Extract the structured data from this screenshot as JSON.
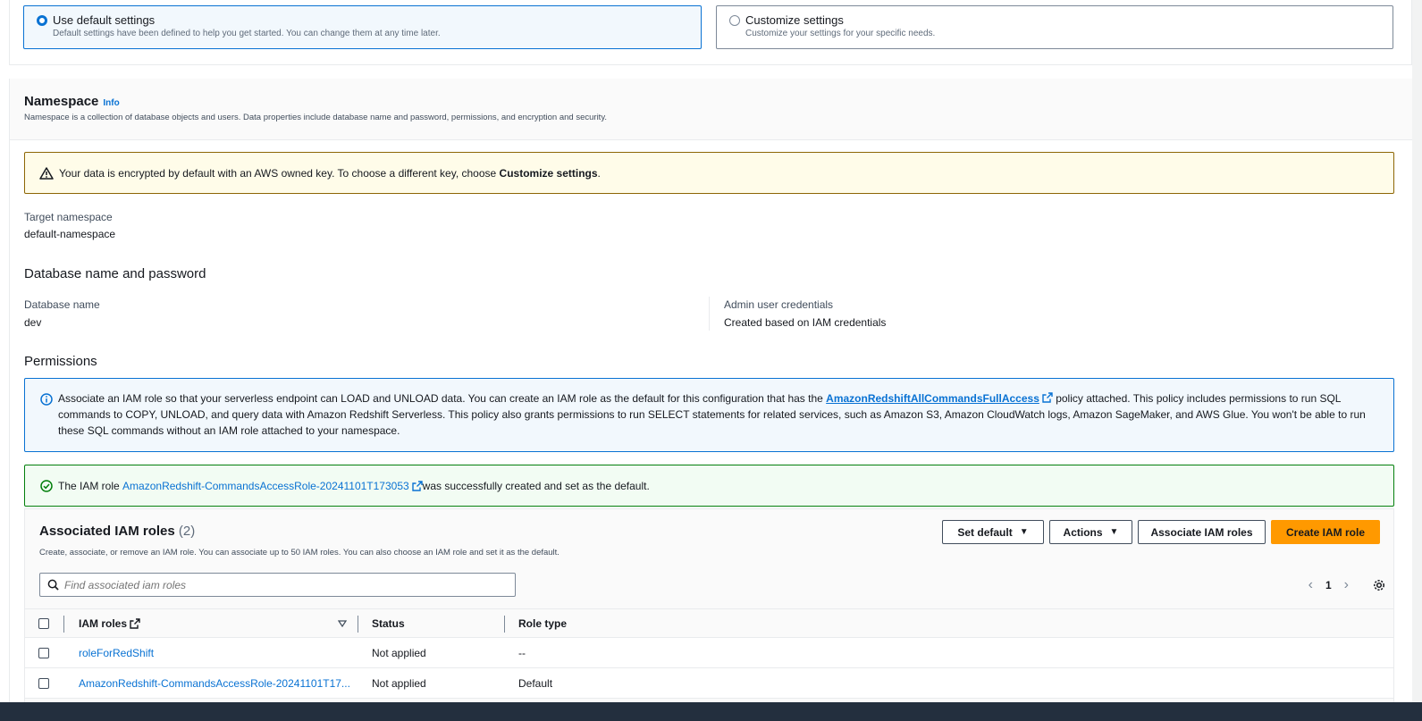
{
  "settings": {
    "default_option": {
      "title": "Use default settings",
      "description": "Default settings have been defined to help you get started. You can change them at any time later.",
      "selected": true
    },
    "custom_option": {
      "title": "Customize settings",
      "description": "Customize your settings for your specific needs.",
      "selected": false
    }
  },
  "namespace": {
    "title": "Namespace",
    "info_label": "Info",
    "description": "Namespace is a collection of database objects and users. Data properties include database name and password, permissions, and encryption and security.",
    "warning": {
      "text": "Your data is encrypted by default with an AWS owned key. To choose a different key, choose ",
      "bold": "Customize settings",
      "end": "."
    },
    "target_label": "Target namespace",
    "target_value": "default-namespace",
    "db_heading": "Database name and password",
    "db_name_label": "Database name",
    "db_name_value": "dev",
    "admin_label": "Admin user credentials",
    "admin_value": "Created based on IAM credentials",
    "permissions_heading": "Permissions"
  },
  "info_alert": {
    "before": "Associate an IAM role so that your serverless endpoint can LOAD and UNLOAD data. You can create an IAM role as the default for this configuration that has the ",
    "link": "AmazonRedshiftAllCommandsFullAccess",
    "after": " policy attached. This policy includes permissions to run SQL commands to COPY, UNLOAD, and query data with Amazon Redshift Serverless. This policy also grants permissions to run SELECT statements for related services, such as Amazon S3, Amazon CloudWatch logs, Amazon SageMaker, and AWS Glue. You won't be able to run these SQL commands without an IAM role attached to your namespace."
  },
  "success_alert": {
    "before": "The IAM role ",
    "link": "AmazonRedshift-CommandsAccessRole-20241101T173053",
    "after": " was successfully created and set as the default."
  },
  "roles": {
    "title": "Associated IAM roles",
    "count": "(2)",
    "description": "Create, associate, or remove an IAM role. You can associate up to 50 IAM roles. You can also choose an IAM role and set it as the default.",
    "buttons": {
      "set_default": "Set default",
      "actions": "Actions",
      "associate": "Associate IAM roles",
      "create": "Create IAM role"
    },
    "search_placeholder": "Find associated iam roles",
    "page": "1",
    "columns": {
      "role": "IAM roles",
      "status": "Status",
      "type": "Role type"
    },
    "rows": [
      {
        "role": "roleForRedShift",
        "status": "Not applied",
        "type": "--"
      },
      {
        "role": "AmazonRedshift-CommandsAccessRole-20241101T17...",
        "status": "Not applied",
        "type": "Default"
      }
    ]
  },
  "colors": {
    "accent": "#0972d3",
    "primary_button": "#ff9900",
    "success": "#037f0c",
    "warning": "#8d6605"
  }
}
